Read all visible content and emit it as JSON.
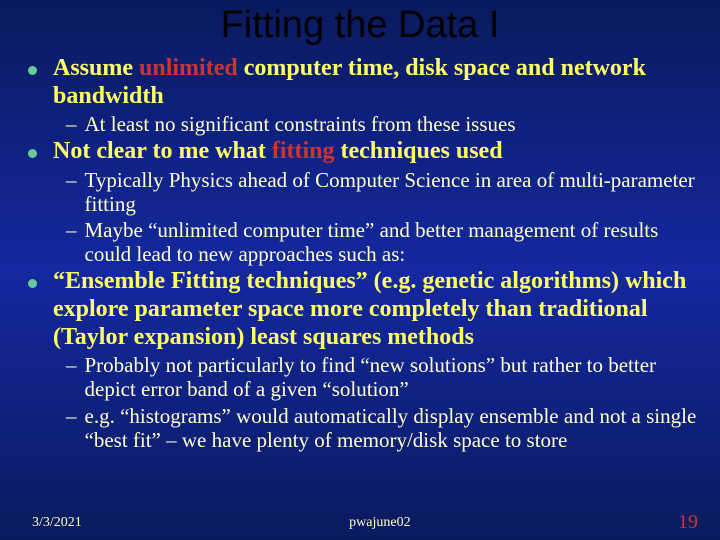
{
  "title": "Fitting the Data I",
  "bullets": [
    {
      "pre": "Assume ",
      "em": "unlimited",
      "post": " computer time, disk space and network bandwidth",
      "subs": [
        "At least no significant constraints from these issues"
      ]
    },
    {
      "pre": "Not clear to me what ",
      "em": "fitting",
      "post": " techniques used",
      "subs": [
        "Typically Physics ahead of Computer Science in area of multi-parameter fitting",
        "Maybe “unlimited computer time” and better management of results could lead to new approaches such as:"
      ]
    },
    {
      "pre": "“Ensemble Fitting techniques” (e.g. genetic algorithms) which explore parameter space more completely than traditional (Taylor expansion) least squares methods",
      "em": "",
      "post": "",
      "subs": [
        "Probably not particularly to find “new solutions” but rather to better depict error band of a given “solution”",
        "e.g. “histograms” would automatically display ensemble and not a single “best fit” – we have plenty of memory/disk space to store"
      ]
    }
  ],
  "footer": {
    "left": "3/3/2021",
    "center": "pwajune02",
    "right": "19"
  }
}
